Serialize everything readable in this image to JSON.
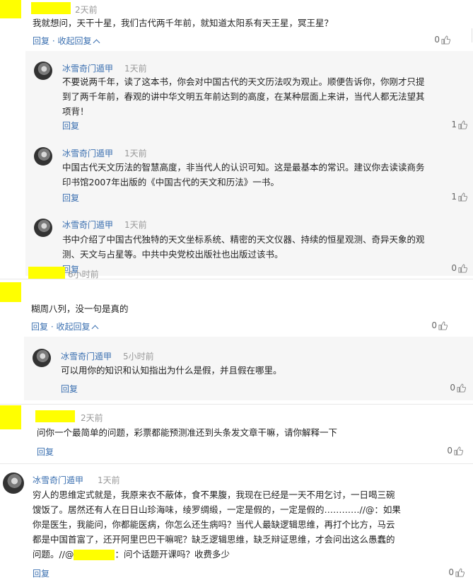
{
  "comments": [
    {
      "time": "2天前",
      "text": "我就想问，天干十星，我们古代两千年前，就知道太阳系有天王星，冥王星？",
      "reply_label": "回复",
      "collapse_label": "收起回复",
      "likes": "0",
      "replies": [
        {
          "author": "冰雪奇门遁甲",
          "time": "1天前",
          "text_lines": [
            "不要说两千年，读了这本书，你会对中国古代的天文历法叹为观止。顺便告诉你，你刚才只提",
            "到了两千年前，春观的讲中华文明五年前达到的高度，在某种层面上来讲，当代人都无法望其",
            "项背！"
          ],
          "reply_label": "回复",
          "likes": "1"
        },
        {
          "author": "冰雪奇门遁甲",
          "time": "1天前",
          "text_lines": [
            "中国古代天文历法的智慧高度，非当代人的认识可知。这是最基本的常识。建议你去读读商务",
            "印书馆2007年出版的《中国古代的天文和历法》一书。"
          ],
          "reply_label": "回复",
          "likes": "1"
        },
        {
          "author": "冰雪奇门遁甲",
          "time": "1天前",
          "text_lines": [
            "书中介绍了中国古代独特的天文坐标系统、精密的天文仪器、持续的恒星观测、奇异天象的观",
            "测、天文与占星等。中共中央党校出版社也出版过该书。"
          ],
          "reply_label": "回复",
          "likes": "0"
        }
      ]
    },
    {
      "time": "6小时前",
      "text": "糊周八列，没一句是真的",
      "reply_label": "回复",
      "collapse_label": "收起回复",
      "likes": "0",
      "replies": [
        {
          "author": "冰雪奇门遁甲",
          "time": "5小时前",
          "text_lines": [
            "可以用你的知识和认知指出为什么是假，并且假在哪里。"
          ],
          "reply_label": "回复",
          "likes": "0"
        }
      ]
    },
    {
      "time": "2天前",
      "text": "问你一个最简单的问题，彩票都能预测准还到头条发文章干嘛，请你解释一下",
      "reply_label": "回复",
      "likes": "0"
    },
    {
      "author": "冰雪奇门遁甲",
      "time": "1天前",
      "text_lines": [
        "穷人的思维定式就是，我原来衣不蔽体，食不果腹，我现在已经是一天不用乞讨，一日喝三碗",
        "馊饭了。居然还有人在日日山珍海味，绫罗绸缎，一定是假的，一定是假的…………//@：如果",
        "你是医生，我能问，你都能医病，你怎么还生病吗？当代人最缺逻辑思维，再打个比方，马云",
        "都是中国首富了，还开阿里巴巴干嘛呢？缺乏逻辑思维，缺乏辩证思维，才会问出这么愚蠢的",
        "问题。//@"
      ],
      "text_tail": "：问个话题开课吗？收费多少",
      "reply_label": "回复",
      "likes": "0"
    }
  ],
  "separator": "·",
  "colors": {
    "link": "#3a6fb0",
    "mask": "#ffff00",
    "reply_bg": "#f6f6f6"
  },
  "icons": {
    "like": "thumbs-up-icon",
    "collapse": "chevron-up-icon",
    "avatar": "user-avatar"
  }
}
